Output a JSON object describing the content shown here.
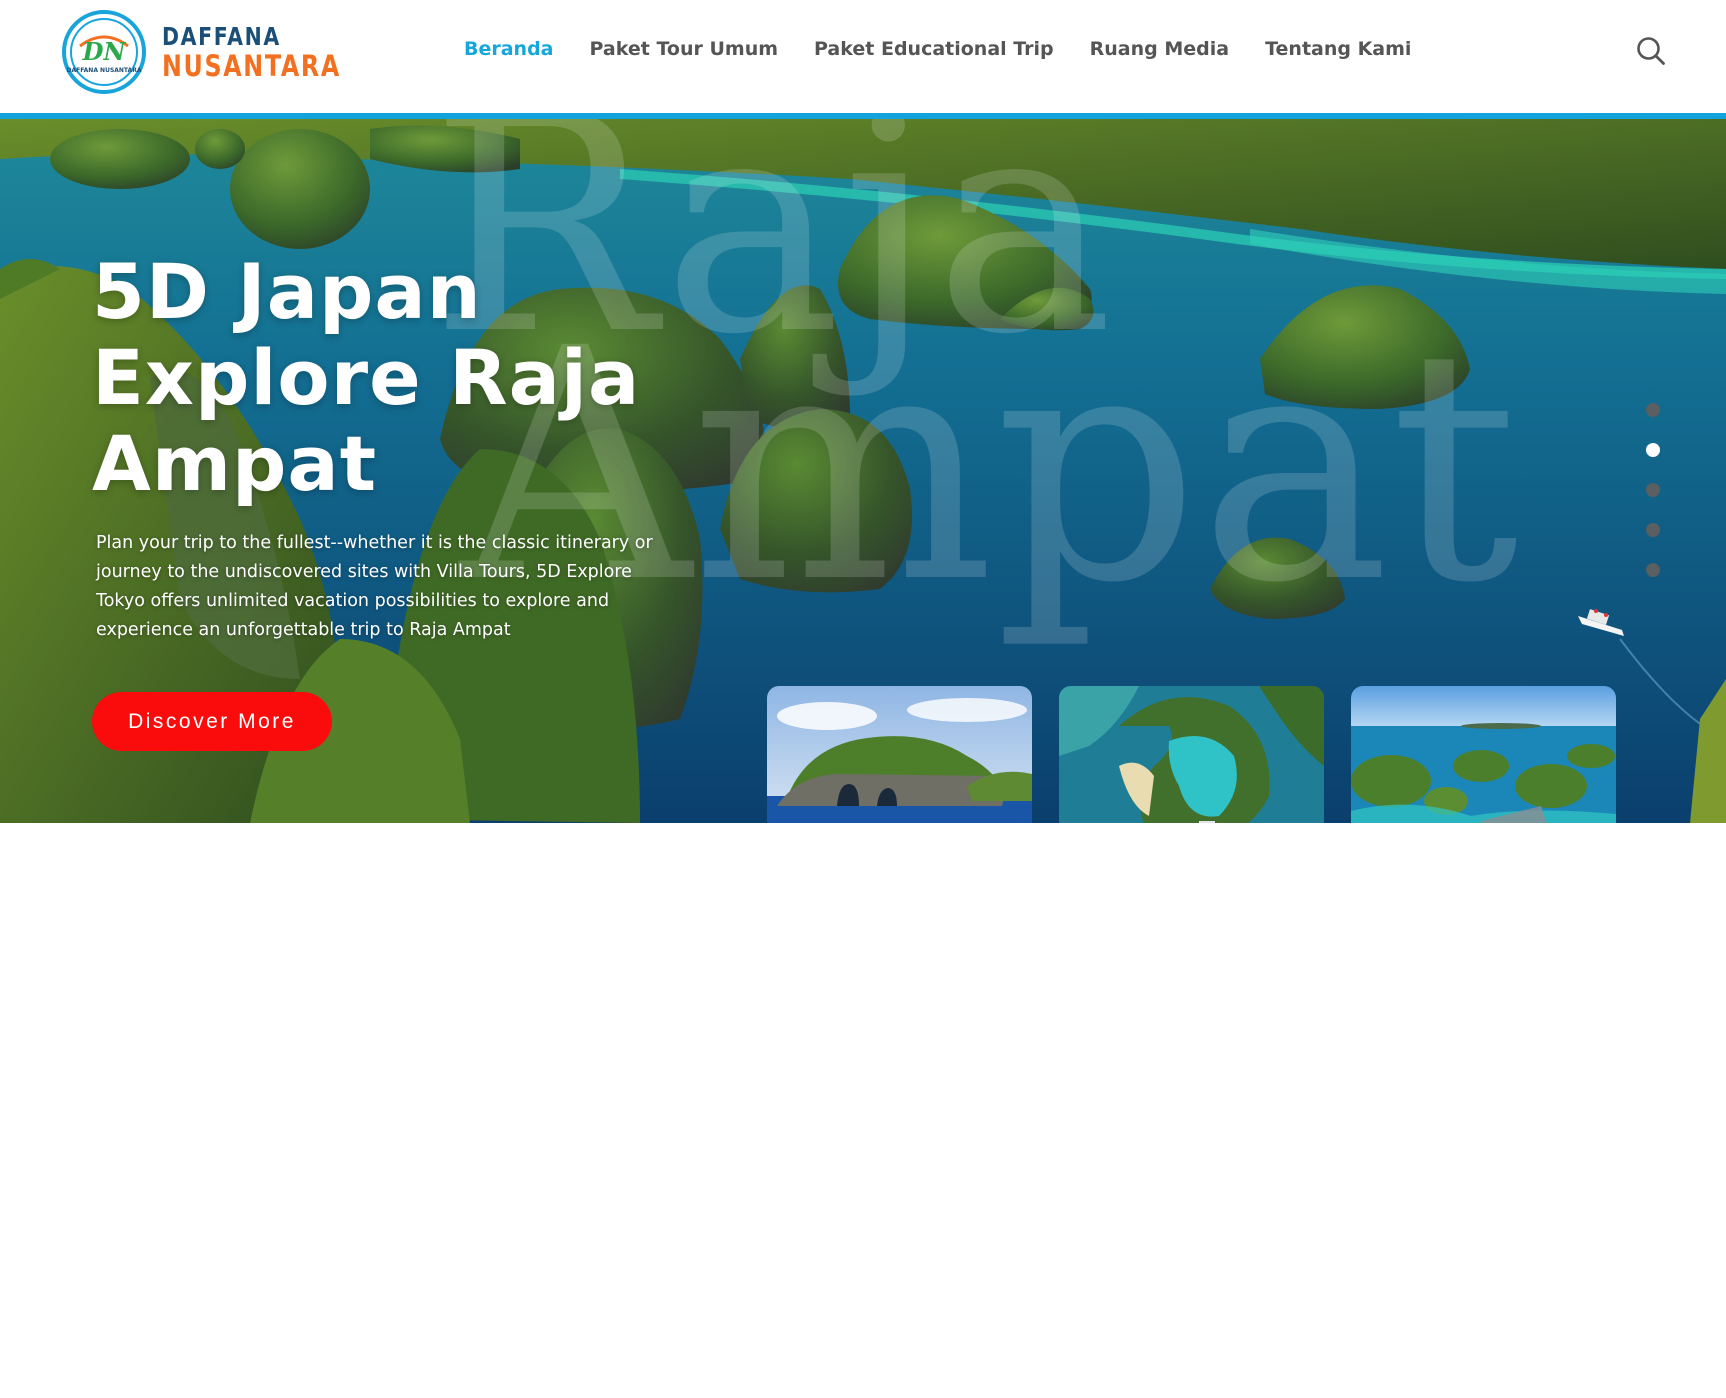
{
  "brand": {
    "name_line1": "DAFFANA",
    "name_line2": "NUSANTARA",
    "emblem_initials": "DN",
    "emblem_caption": "DAFFANA NUSANTARA",
    "colors": {
      "navy": "#1b4f77",
      "orange": "#f37021",
      "cyan": "#12a3dd"
    }
  },
  "nav": {
    "items": [
      {
        "label": "Beranda",
        "active": true
      },
      {
        "label": "Paket Tour Umum",
        "active": false
      },
      {
        "label": "Paket Educational Trip",
        "active": false
      },
      {
        "label": "Ruang Media",
        "active": false
      },
      {
        "label": "Tentang Kami",
        "active": false
      }
    ],
    "active_color": "#15a7dc",
    "search_icon": "search-icon"
  },
  "hero": {
    "watermark_line1": "Raja",
    "watermark_line2": "Ampat",
    "title_line1": "5D Japan",
    "title_line2": "Explore Raja",
    "title_line3": "Ampat",
    "description": "Plan your trip to the fullest--whether it is the classic itinerary or journey to the undiscovered sites with Villa Tours, 5D Explore Tokyo offers unlimited vacation possibilities to explore and experience an unforgettable trip to Raja Ampat",
    "cta_label": "Discover More",
    "cta_color": "#fa0c0c",
    "slides_total": 5,
    "active_slide": 2,
    "thumbnails": [
      {
        "scene": "rock-arch-island"
      },
      {
        "scene": "lagoon-aerial"
      },
      {
        "scene": "karst-islands-view"
      }
    ]
  }
}
